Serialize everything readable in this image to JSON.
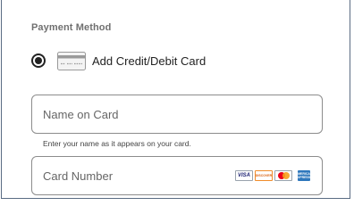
{
  "payment": {
    "section_title": "Payment Method",
    "option_label": "Add Credit/Debit Card",
    "option_selected": true,
    "option_icon": "credit-card-icon"
  },
  "name_field": {
    "placeholder": "Name on Card",
    "value": "",
    "helper": "Enter your name as it appears on your card."
  },
  "number_field": {
    "placeholder": "Card Number",
    "value": "",
    "accepted_brands": [
      {
        "name": "visa-logo",
        "text": "VISA"
      },
      {
        "name": "discover-logo",
        "text": "DISCOVER"
      },
      {
        "name": "mastercard-logo"
      },
      {
        "name": "amex-logo",
        "text": "AMERICAN EXPRESS"
      }
    ]
  },
  "colors": {
    "border": "#8c8c8c",
    "panel_border": "#5a6c83",
    "title": "#707070",
    "text": "#222222"
  }
}
